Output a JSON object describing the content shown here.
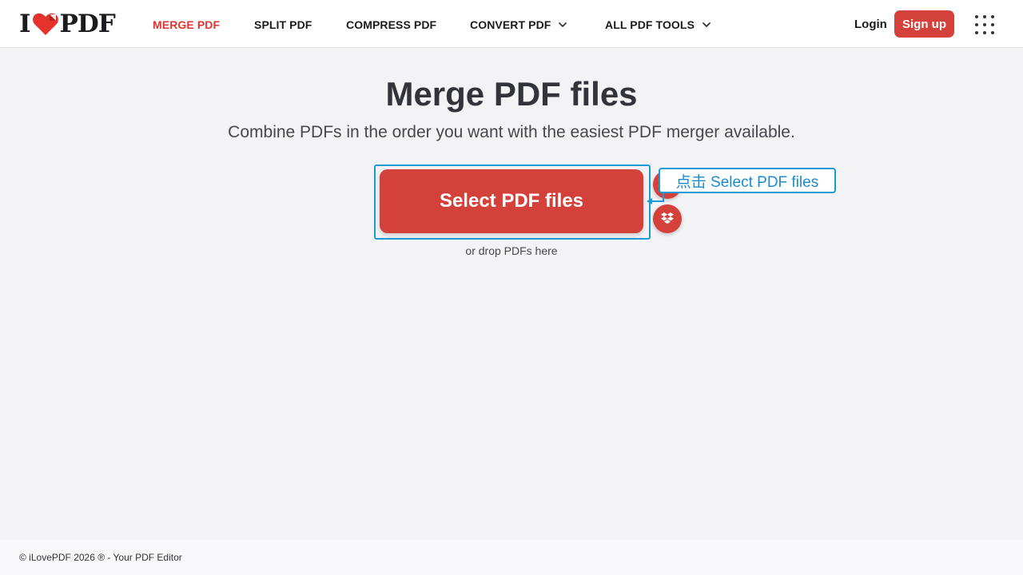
{
  "header": {
    "logo": {
      "left": "I",
      "right": "PDF"
    },
    "nav": [
      {
        "label": "MERGE PDF",
        "active": true
      },
      {
        "label": "SPLIT PDF"
      },
      {
        "label": "COMPRESS PDF"
      },
      {
        "label": "CONVERT PDF",
        "dropdown": true
      },
      {
        "label": "ALL PDF TOOLS",
        "dropdown": true
      }
    ],
    "login_label": "Login",
    "signup_label": "Sign up"
  },
  "main": {
    "title": "Merge PDF files",
    "subtitle": "Combine PDFs in the order you want with the easiest PDF merger available.",
    "select_button_label": "Select PDF files",
    "drop_hint": "or drop PDFs here",
    "cloud_buttons": [
      "google-drive-icon",
      "dropbox-icon"
    ]
  },
  "annotation": {
    "label": "点击 Select PDF files"
  },
  "footer": {
    "text": "© iLovePDF 2026 ® - Your PDF Editor"
  },
  "colors": {
    "brand_red": "#d4413a",
    "accent_active": "#e5322d",
    "annotation_blue": "#1a9bd7",
    "background": "#f3f2f5"
  }
}
